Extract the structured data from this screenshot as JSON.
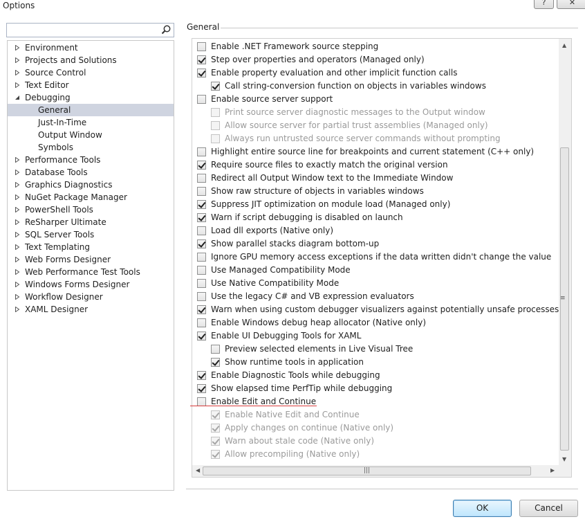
{
  "window": {
    "title": "Options",
    "help_label": "?",
    "close_label": "✕"
  },
  "search": {
    "value": "",
    "placeholder": ""
  },
  "tree": {
    "items": [
      {
        "label": "Environment",
        "expandable": true,
        "expanded": false
      },
      {
        "label": "Projects and Solutions",
        "expandable": true,
        "expanded": false
      },
      {
        "label": "Source Control",
        "expandable": true,
        "expanded": false
      },
      {
        "label": "Text Editor",
        "expandable": true,
        "expanded": false
      },
      {
        "label": "Debugging",
        "expandable": true,
        "expanded": true
      },
      {
        "label": "General",
        "child": true,
        "selected": true
      },
      {
        "label": "Just-In-Time",
        "child": true
      },
      {
        "label": "Output Window",
        "child": true
      },
      {
        "label": "Symbols",
        "child": true
      },
      {
        "label": "Performance Tools",
        "expandable": true,
        "expanded": false
      },
      {
        "label": "Database Tools",
        "expandable": true,
        "expanded": false
      },
      {
        "label": "Graphics Diagnostics",
        "expandable": true,
        "expanded": false
      },
      {
        "label": "NuGet Package Manager",
        "expandable": true,
        "expanded": false
      },
      {
        "label": "PowerShell Tools",
        "expandable": true,
        "expanded": false
      },
      {
        "label": "ReSharper Ultimate",
        "expandable": true,
        "expanded": false
      },
      {
        "label": "SQL Server Tools",
        "expandable": true,
        "expanded": false
      },
      {
        "label": "Text Templating",
        "expandable": true,
        "expanded": false
      },
      {
        "label": "Web Forms Designer",
        "expandable": true,
        "expanded": false
      },
      {
        "label": "Web Performance Test Tools",
        "expandable": true,
        "expanded": false
      },
      {
        "label": "Windows Forms Designer",
        "expandable": true,
        "expanded": false
      },
      {
        "label": "Workflow Designer",
        "expandable": true,
        "expanded": false
      },
      {
        "label": "XAML Designer",
        "expandable": true,
        "expanded": false
      }
    ]
  },
  "general": {
    "group_label": "General",
    "options": [
      {
        "label": "Enable .NET Framework source stepping",
        "checked": false,
        "indent": 0,
        "enabled": true
      },
      {
        "label": "Step over properties and operators (Managed only)",
        "checked": true,
        "indent": 0,
        "enabled": true
      },
      {
        "label": "Enable property evaluation and other implicit function calls",
        "checked": true,
        "indent": 0,
        "enabled": true
      },
      {
        "label": "Call string-conversion function on objects in variables windows",
        "checked": true,
        "indent": 1,
        "enabled": true
      },
      {
        "label": "Enable source server support",
        "checked": false,
        "indent": 0,
        "enabled": true
      },
      {
        "label": "Print source server diagnostic messages to the Output window",
        "checked": false,
        "indent": 1,
        "enabled": false
      },
      {
        "label": "Allow source server for partial trust assemblies (Managed only)",
        "checked": false,
        "indent": 1,
        "enabled": false
      },
      {
        "label": "Always run untrusted source server commands without prompting",
        "checked": false,
        "indent": 1,
        "enabled": false
      },
      {
        "label": "Highlight entire source line for breakpoints and current statement (C++ only)",
        "checked": false,
        "indent": 0,
        "enabled": true
      },
      {
        "label": "Require source files to exactly match the original version",
        "checked": true,
        "indent": 0,
        "enabled": true
      },
      {
        "label": "Redirect all Output Window text to the Immediate Window",
        "checked": false,
        "indent": 0,
        "enabled": true
      },
      {
        "label": "Show raw structure of objects in variables windows",
        "checked": false,
        "indent": 0,
        "enabled": true
      },
      {
        "label": "Suppress JIT optimization on module load (Managed only)",
        "checked": true,
        "indent": 0,
        "enabled": true
      },
      {
        "label": "Warn if script debugging is disabled on launch",
        "checked": true,
        "indent": 0,
        "enabled": true
      },
      {
        "label": "Load dll exports (Native only)",
        "checked": false,
        "indent": 0,
        "enabled": true
      },
      {
        "label": "Show parallel stacks diagram bottom-up",
        "checked": true,
        "indent": 0,
        "enabled": true
      },
      {
        "label": "Ignore GPU memory access exceptions if the data written didn't change the value",
        "checked": false,
        "indent": 0,
        "enabled": true
      },
      {
        "label": "Use Managed Compatibility Mode",
        "checked": false,
        "indent": 0,
        "enabled": true
      },
      {
        "label": "Use Native Compatibility Mode",
        "checked": false,
        "indent": 0,
        "enabled": true
      },
      {
        "label": "Use the legacy C# and VB expression evaluators",
        "checked": false,
        "indent": 0,
        "enabled": true
      },
      {
        "label": "Warn when using custom debugger visualizers against potentially unsafe processes (Managed o",
        "checked": true,
        "indent": 0,
        "enabled": true
      },
      {
        "label": "Enable Windows debug heap allocator (Native only)",
        "checked": false,
        "indent": 0,
        "enabled": true
      },
      {
        "label": "Enable UI Debugging Tools for XAML",
        "checked": true,
        "indent": 0,
        "enabled": true
      },
      {
        "label": "Preview selected elements in Live Visual Tree",
        "checked": false,
        "indent": 1,
        "enabled": true
      },
      {
        "label": "Show runtime tools in application",
        "checked": true,
        "indent": 1,
        "enabled": true
      },
      {
        "label": "Enable Diagnostic Tools while debugging",
        "checked": true,
        "indent": 0,
        "enabled": true
      },
      {
        "label": "Show elapsed time PerfTip while debugging",
        "checked": true,
        "indent": 0,
        "enabled": true
      },
      {
        "label": "Enable Edit and Continue",
        "checked": false,
        "indent": 0,
        "enabled": true,
        "highlighted": true
      },
      {
        "label": "Enable Native Edit and Continue",
        "checked": true,
        "indent": 1,
        "enabled": false
      },
      {
        "label": "Apply changes on continue (Native only)",
        "checked": true,
        "indent": 1,
        "enabled": false
      },
      {
        "label": "Warn about stale code (Native only)",
        "checked": true,
        "indent": 1,
        "enabled": false
      },
      {
        "label": "Allow precompiling (Native only)",
        "checked": true,
        "indent": 1,
        "enabled": false
      }
    ]
  },
  "buttons": {
    "ok_label": "OK",
    "cancel_label": "Cancel"
  },
  "colors": {
    "selection": "#cfd4e0",
    "annotation_underline": "#d83a3a",
    "disabled_text": "#9a9a9a"
  }
}
